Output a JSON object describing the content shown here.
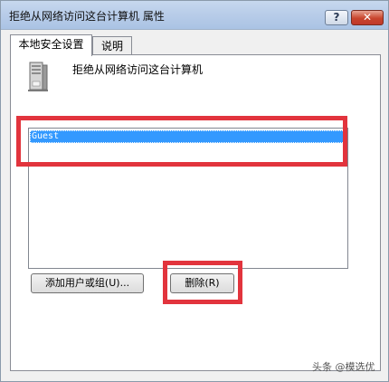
{
  "window": {
    "title": "拒绝从网络访问这台计算机 属性",
    "help_label": "?",
    "close_label": "✕"
  },
  "tabs": [
    {
      "label": "本地安全设置",
      "active": true
    },
    {
      "label": "说明",
      "active": false
    }
  ],
  "policy": {
    "icon": "server-icon",
    "title": "拒绝从网络访问这台计算机"
  },
  "list": {
    "items": [
      "Guest"
    ],
    "selected_index": 0
  },
  "buttons": {
    "add_label": "添加用户或组(U)...",
    "remove_label": "删除(R)"
  },
  "annotations": {
    "highlight_color": "#e2343d",
    "selection_color": "#3399ff"
  },
  "watermark": "头条 @模选优"
}
